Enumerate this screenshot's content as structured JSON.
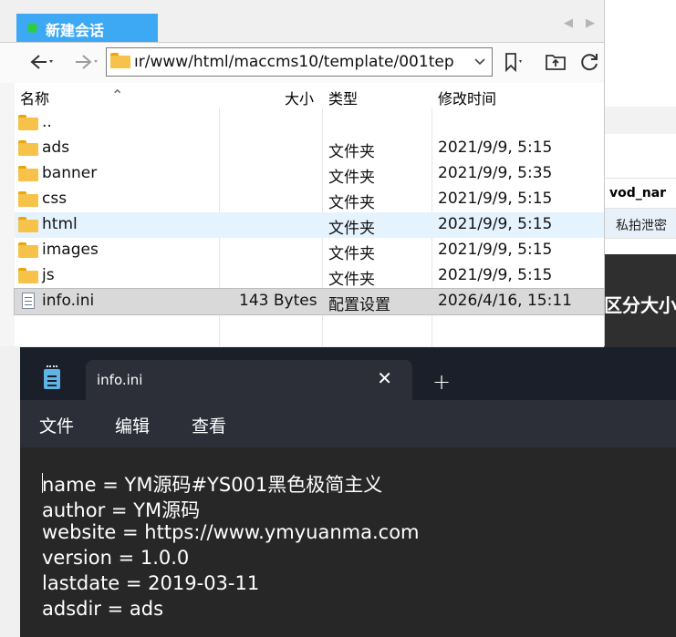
{
  "file_manager": {
    "session_tab": "新建会话",
    "address": "ır/www/html/maccms10/template/001tep",
    "columns": {
      "name": "名称",
      "size": "大小",
      "type": "类型",
      "modified": "修改时间"
    },
    "rows": [
      {
        "name": "..",
        "size": "",
        "type": "",
        "modified": ""
      },
      {
        "name": "ads",
        "size": "",
        "type": "文件夹",
        "modified": "2021/9/9, 5:15"
      },
      {
        "name": "banner",
        "size": "",
        "type": "文件夹",
        "modified": "2021/9/9, 5:35"
      },
      {
        "name": "css",
        "size": "",
        "type": "文件夹",
        "modified": "2021/9/9, 5:15"
      },
      {
        "name": "html",
        "size": "",
        "type": "文件夹",
        "modified": "2021/9/9, 5:15"
      },
      {
        "name": "images",
        "size": "",
        "type": "文件夹",
        "modified": "2021/9/9, 5:15"
      },
      {
        "name": "js",
        "size": "",
        "type": "文件夹",
        "modified": "2021/9/9, 5:15"
      },
      {
        "name": "info.ini",
        "size": "143 Bytes",
        "type": "配置设置",
        "modified": "2026/4/16, 15:11"
      }
    ]
  },
  "background_app": {
    "column_header": "vod_nar",
    "cell": "私拍泄密",
    "banner": "区分大小"
  },
  "notepad": {
    "tab_title": "info.ini",
    "menu": [
      "文件",
      "编辑",
      "查看"
    ],
    "lines": [
      "name = YM源码#YS001黑色极简主义",
      "author = YM源码",
      "website = https://www.ymyuanma.com",
      "version = 1.0.0",
      "lastdate = 2019-03-11",
      "adsdir = ads"
    ]
  }
}
